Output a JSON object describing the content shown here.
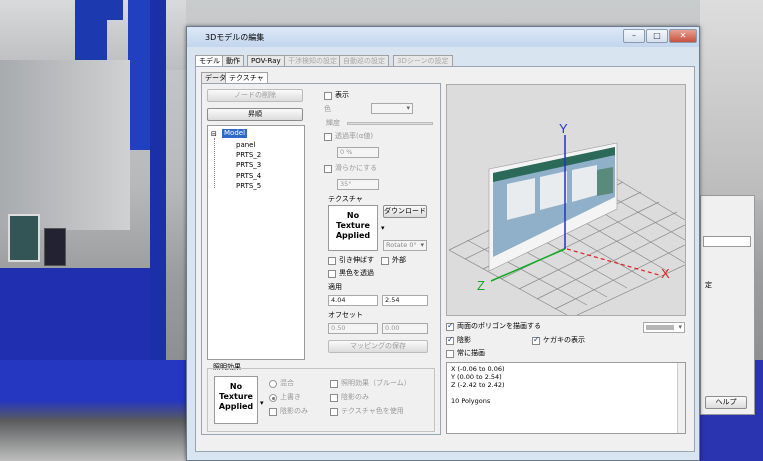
{
  "window": {
    "title": "3Dモデルの編集",
    "minimize": "–",
    "maximize": "□",
    "close": "✕"
  },
  "tabs": [
    "モデル",
    "動作",
    "POV-Ray",
    "干渉検知の設定",
    "自動巡の設定",
    "3Dシーンの設定"
  ],
  "subtabs": [
    "データ",
    "テクスチャ"
  ],
  "left": {
    "delete_node": "ノードの削除",
    "apply": "昇順",
    "tree_root": "Model",
    "tree_items": [
      "panel",
      "PRTS_2",
      "PRTS_3",
      "PRTS_4",
      "PRTS_5"
    ]
  },
  "mid": {
    "display": "表示",
    "color": "色",
    "glow": "輝度",
    "transparency": "透過率(α値)",
    "transparency_value": "0 %",
    "smooth": "滑らかにする",
    "smooth_value": "35°",
    "texture_header": "テクスチャ",
    "no_texture": "No Texture Applied",
    "download": "ダウンロード",
    "rotate": "Rotate 0°",
    "stretch": "引き伸ばす",
    "external": "外部",
    "mark_transparent": "黒色を透過",
    "apply_header": "適用",
    "apply_x": "4.04",
    "apply_y": "2.54",
    "offset_header": "オフセット",
    "offset_x": "0.50",
    "offset_y": "0.00",
    "save_mapping": "マッピングの保存"
  },
  "lighting": {
    "header": "照明効果",
    "no_texture": "No Texture Applied",
    "mix": "混合",
    "overwrite": "上書き",
    "shadow_only": "陰影のみ",
    "bloom": "照明効果（ブルーム）",
    "shadow_only2": "陰影のみ",
    "use_texture_color": "テクスチャ色を使用"
  },
  "preview": {
    "draw_both_sides": "両面のポリゴンを描画する",
    "shadow": "陰影",
    "show_outline": "ケガキの表示",
    "always_draw": "常に描画",
    "info": [
      "X (-0.06 to 0.06)",
      "Y (0.00 to 2.54)",
      "Z (-2.42 to 2.42)",
      "",
      "10 Polygons"
    ],
    "axis_x": "X",
    "axis_y": "Y",
    "axis_z": "Z"
  },
  "background_window": {
    "help": "ヘルプ",
    "label": "定"
  },
  "colors": {
    "selection": "#3169c6",
    "axis_x": "#e02020",
    "axis_y": "#2233cc",
    "axis_z": "#11aa22"
  }
}
